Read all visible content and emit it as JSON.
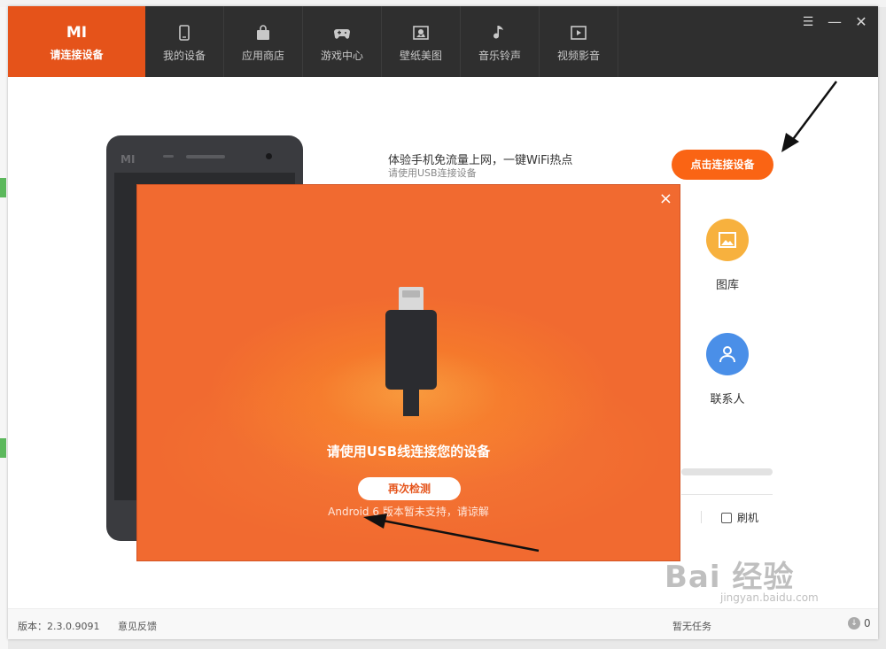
{
  "app": {
    "tabs": [
      {
        "label": "请连接设备",
        "icon": "mi-logo",
        "logo_text": "MI"
      },
      {
        "label": "我的设备",
        "icon": "phone-icon"
      },
      {
        "label": "应用商店",
        "icon": "bag-icon"
      },
      {
        "label": "游戏中心",
        "icon": "gamepad-icon"
      },
      {
        "label": "壁纸美图",
        "icon": "picture-icon"
      },
      {
        "label": "音乐铃声",
        "icon": "music-note-icon"
      },
      {
        "label": "视频影音",
        "icon": "play-icon"
      }
    ],
    "window_controls": {
      "menu": "☰",
      "minimize": "—",
      "close": "✕"
    }
  },
  "main": {
    "phone_logo": "MI",
    "headline": "体验手机免流量上网，一键WiFi热点",
    "subline": "请使用USB连接设备",
    "connect_button": "点击连接设备",
    "features": [
      {
        "label": "图库",
        "icon": "gallery-icon",
        "color": "#f7b13e"
      },
      {
        "label": "联系人",
        "icon": "contact-icon",
        "color": "#4a8fe8"
      }
    ],
    "flash_label": "刷机"
  },
  "modal": {
    "close": "×",
    "title": "请使用USB线连接您的设备",
    "retry_button": "再次检测",
    "note": "Android 6 版本暂未支持，请谅解"
  },
  "footer": {
    "version": "版本：2.3.0.9091",
    "feedback": "意见反馈",
    "task_label": "暂无任务",
    "download_count": "0"
  },
  "watermark": {
    "brand": "Bai 经验",
    "url": "jingyan.baidu.com"
  },
  "colors": {
    "accent": "#e5531a",
    "topbar": "#2f2f2f",
    "modal": "#f26b2f"
  }
}
